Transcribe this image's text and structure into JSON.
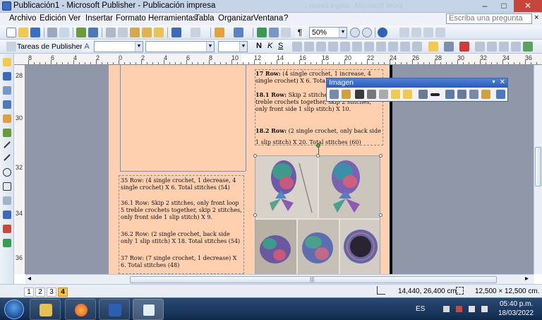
{
  "window": {
    "title": "Publicación1 - Microsoft Publisher - Publicación impresa",
    "ghost_title": "...nuevo.inglés - Microsoft Word",
    "min": "–",
    "max": "□",
    "close": "✕"
  },
  "menu": {
    "items": [
      "Archivo",
      "Edición",
      "Ver",
      "Insertar",
      "Formato",
      "Herramientas",
      "Tabla",
      "Organizar",
      "Ventana",
      "?"
    ],
    "help_placeholder": "Escriba una pregunta",
    "help_close": "×"
  },
  "toolbar": {
    "zoom": "50%",
    "publisher_tasks": "Tareas de Publisher",
    "style_value": "",
    "font_value": "",
    "size_value": "",
    "bold": "N",
    "italic": "K",
    "underline": "S"
  },
  "ruler_h": [
    "8",
    "6",
    "4",
    "2",
    "0",
    "2",
    "4",
    "6",
    "8",
    "10",
    "12",
    "14",
    "16",
    "18",
    "20",
    "22",
    "24",
    "26",
    "28",
    "30",
    "32",
    "34",
    "36"
  ],
  "ruler_v": [
    "28",
    "30",
    "32",
    "34",
    "36"
  ],
  "text_upper": {
    "p1_bold": "17 Row:",
    "p1": " (4 single crochet, 1 increase, 4 single crochet) X 6. Total stitches (54)",
    "p2_bold": "18.1 Row:",
    "p2": " Skip 2 stitches, only front loop 5 treble crochets together, skip 2 stitches, only front side 1 slip stitch) X 10.",
    "p3_bold": "18.2 Row:",
    "p3": " (2 single crochet, only back side 1 slip stitch) X 20. Total stitches (60)"
  },
  "text_lower": {
    "p1": "35 Row: (4 single crochet, 1 decrease, 4 single crochet) X 6. Total stitches (54)",
    "p2": "36.1 Row: Skip 2 stitches, only front loop 5 treble crochets together, skip 2 stitches, only front side 1 slip stitch) X 9.",
    "p3": "36.2 Row: (2 single crochet, back side only 1 slip stitch) X 18. Total stitches (54)",
    "p4": "37 Row: (7 single crochet, 1 decrease) X 6. Total stitches (48)"
  },
  "image_toolbar": {
    "title": "Imagen",
    "close": "✕",
    "dropdown": "▼"
  },
  "hscroll": {
    "left": "◂",
    "right": "▸",
    "grip": "|||"
  },
  "status": {
    "pages": [
      "1",
      "2",
      "3",
      "4"
    ],
    "active_page": 4,
    "position": "14,440, 26,400 cm.",
    "size": "12,500 × 12,500 cm."
  },
  "taskbar": {
    "lang": "ES",
    "time": "05:40 p.m.",
    "date": "18/03/2022"
  }
}
